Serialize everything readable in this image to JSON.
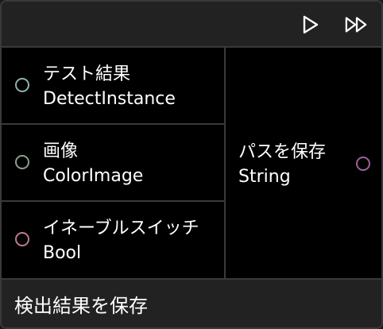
{
  "toolbar": {
    "run_icon": "play-icon",
    "run_all_icon": "fast-forward-icon"
  },
  "inputs": [
    {
      "label": "テスト結果",
      "type": "DetectInstance",
      "color": "#8fb0b0"
    },
    {
      "label": "画像",
      "type": "ColorImage",
      "color": "#8aa08c"
    },
    {
      "label": "イネーブルスイッチ",
      "type": "Bool",
      "color": "#c07a8e"
    }
  ],
  "output": {
    "label": "パスを保存",
    "type": "String",
    "color": "#a0609a"
  },
  "footer": {
    "title": "検出結果を保存"
  }
}
